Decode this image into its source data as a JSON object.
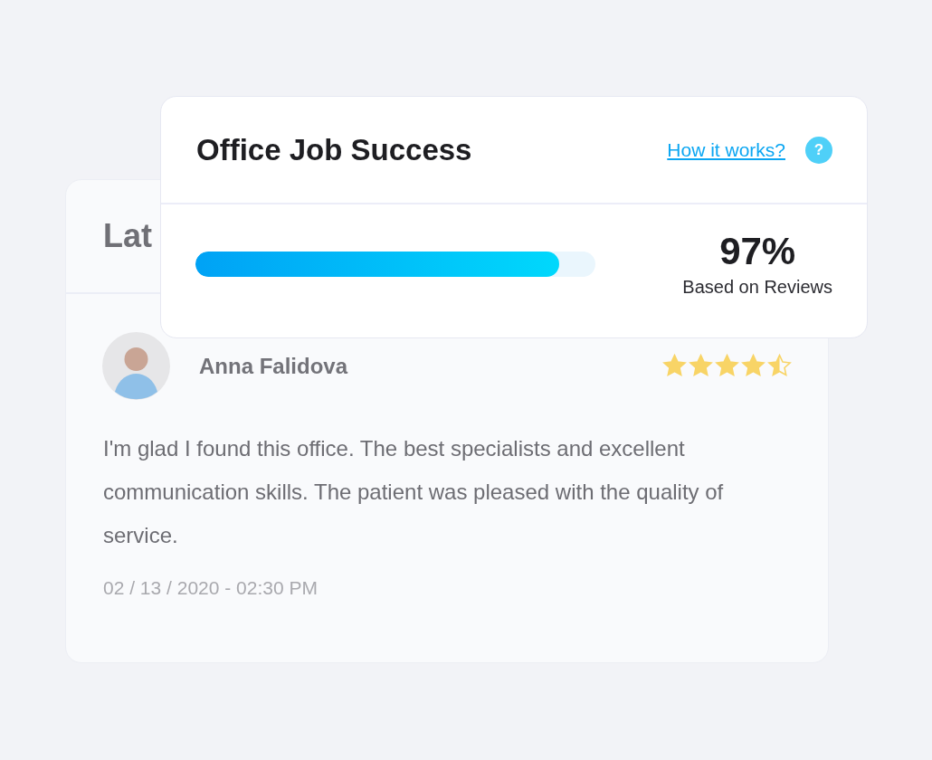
{
  "reviews_card": {
    "title": "Lat",
    "review": {
      "name": "Anna Falidova",
      "stars": 4.5,
      "text": "I'm glad I found this office. The best specialists and excellent communication skills. The patient was pleased with the quality of service.",
      "date": "02 / 13 / 2020 - 02:30 PM"
    }
  },
  "success_card": {
    "title": "Office Job Success",
    "link": "How it works?",
    "help": "?",
    "level": 0.91,
    "percent": "97%",
    "caption": "Based on Reviews"
  }
}
